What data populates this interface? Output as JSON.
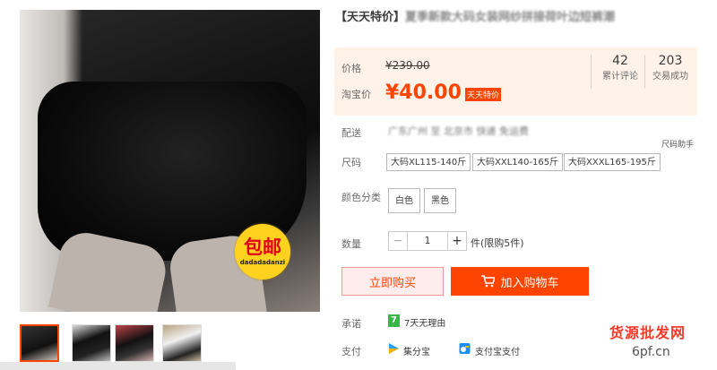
{
  "badge": {
    "text": "包邮",
    "sub": "dadadadanzi"
  },
  "product": {
    "title_tag": "【天天特价】",
    "title_rest": "夏季新款大码女装网纱拼接荷叶边短裤潮"
  },
  "price": {
    "original_label": "价格",
    "original_value": "¥239.00",
    "current_label": "淘宝价",
    "current_value": "¥40.00",
    "promo_tag": "天天特价"
  },
  "stats": [
    {
      "number": "42",
      "label": "累计评论"
    },
    {
      "number": "203",
      "label": "交易成功"
    }
  ],
  "shipping": {
    "label": "配送",
    "value": "广东广州 至 北京市 快递 免运费",
    "helper": "尺码助手"
  },
  "size": {
    "label": "尺码",
    "options": [
      "大码XL115-140斤",
      "大码XXL140-165斤",
      "大码XXXL165-195斤"
    ]
  },
  "color": {
    "label": "颜色分类",
    "options": [
      "白色",
      "黑色"
    ]
  },
  "quantity": {
    "label": "数量",
    "minus": "−",
    "value": "1",
    "plus": "+",
    "limit": "件(限购5件)"
  },
  "buttons": {
    "buy_now": "立即购买",
    "add_cart": "加入购物车"
  },
  "promise": {
    "label": "承诺",
    "icon_text": "7",
    "value": "7天无理由"
  },
  "payment": {
    "label": "支付",
    "methods": [
      "集分宝",
      "支付宝支付"
    ]
  },
  "watermark": {
    "site": "货源批发网",
    "url": "6pf.cn"
  },
  "colors": {
    "accent": "#ff4400",
    "price_bg": "#fff2e8",
    "badge": "#ffd21f"
  }
}
